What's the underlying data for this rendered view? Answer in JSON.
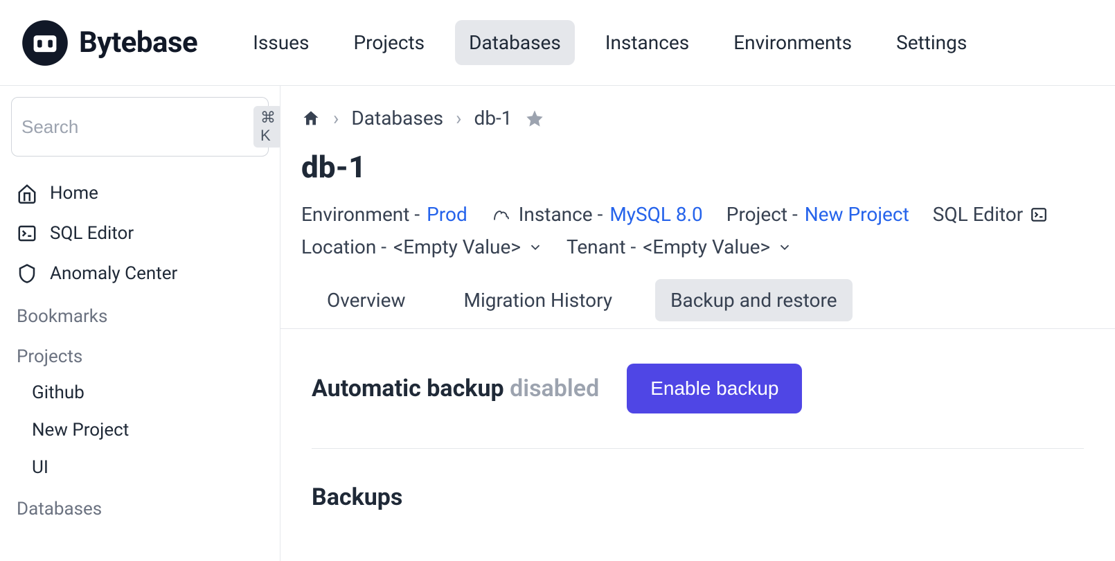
{
  "app": {
    "name": "Bytebase"
  },
  "topnav": {
    "items": [
      {
        "label": "Issues"
      },
      {
        "label": "Projects"
      },
      {
        "label": "Databases",
        "active": true
      },
      {
        "label": "Instances"
      },
      {
        "label": "Environments"
      },
      {
        "label": "Settings"
      }
    ]
  },
  "search": {
    "placeholder": "Search",
    "kbd": "⌘ K"
  },
  "sidebar": {
    "primary": [
      {
        "label": "Home",
        "icon": "home"
      },
      {
        "label": "SQL Editor",
        "icon": "terminal"
      },
      {
        "label": "Anomaly Center",
        "icon": "shield"
      }
    ],
    "sections": [
      {
        "title": "Bookmarks",
        "items": []
      },
      {
        "title": "Projects",
        "items": [
          {
            "label": "Github"
          },
          {
            "label": "New Project"
          },
          {
            "label": "UI"
          }
        ]
      },
      {
        "title": "Databases",
        "items": []
      }
    ]
  },
  "breadcrumb": {
    "items": [
      {
        "label": "Databases"
      },
      {
        "label": "db-1"
      }
    ]
  },
  "page": {
    "title": "db-1"
  },
  "meta": {
    "environment_label": "Environment - ",
    "environment_value": "Prod",
    "instance_label": "Instance - ",
    "instance_value": "MySQL 8.0",
    "project_label": "Project - ",
    "project_value": "New Project",
    "sql_editor_label": "SQL Editor",
    "location_label": "Location - ",
    "location_value": "<Empty Value>",
    "tenant_label": "Tenant - ",
    "tenant_value": "<Empty Value>"
  },
  "tabs": {
    "items": [
      {
        "label": "Overview"
      },
      {
        "label": "Migration History"
      },
      {
        "label": "Backup and restore",
        "active": true
      }
    ]
  },
  "backup": {
    "heading": "Automatic backup",
    "status": "disabled",
    "button": "Enable backup",
    "section_title": "Backups"
  }
}
